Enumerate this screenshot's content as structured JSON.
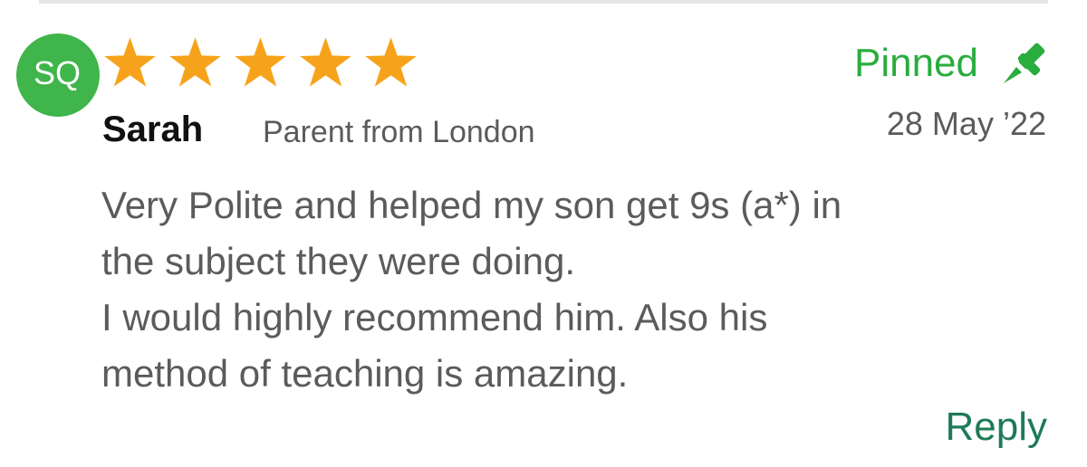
{
  "review": {
    "avatar": {
      "initials": "SQ",
      "color": "#3fb54b"
    },
    "rating": {
      "value": 5,
      "max": 5,
      "star_color": "#f6a31b",
      "icon": "star-icon"
    },
    "reviewer": {
      "name": "Sarah",
      "role": "Parent from London"
    },
    "pinned": {
      "label": "Pinned",
      "icon": "pin-icon",
      "color": "#2aad3f"
    },
    "date": "28 May ’22",
    "body": {
      "lines": [
        "Very Polite and helped my son get 9s (a*) in",
        "the subject they were doing.",
        "I would highly recommend him. Also his",
        "method of teaching is amazing."
      ]
    },
    "reply_label": "Reply",
    "reply_color": "#1f7a57"
  }
}
